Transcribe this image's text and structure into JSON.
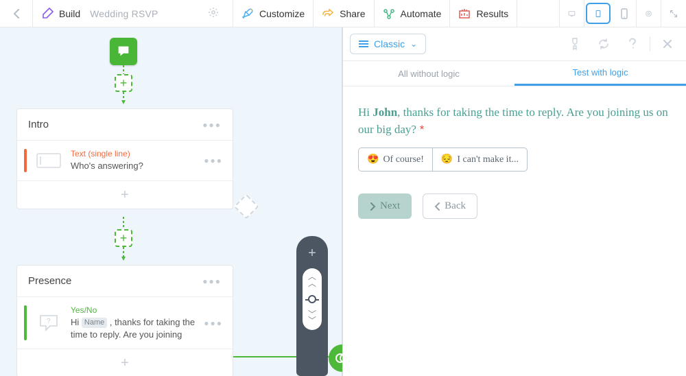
{
  "top": {
    "build": "Build",
    "doc": "Wedding RSVP",
    "customize": "Customize",
    "share": "Share",
    "automate": "Automate",
    "results": "Results"
  },
  "canvas": {
    "intro": {
      "title": "Intro",
      "row_type": "Text (single line)",
      "row_q": "Who's answering?"
    },
    "presence": {
      "title": "Presence",
      "row_type": "Yes/No",
      "row_q_pre": "Hi ",
      "row_q_chip": "Name",
      "row_q_post": " , thanks for taking the time to reply. Are you joining"
    }
  },
  "preview": {
    "theme": "Classic",
    "tab1": "All without logic",
    "tab2": "Test with logic",
    "q_pre": "Hi ",
    "q_name": "John",
    "q_post": ", thanks for taking the time to reply. Are you joining us on our big day?",
    "opt1": "Of course!",
    "opt2": "I can't make it...",
    "next": "Next",
    "back": "Back"
  }
}
